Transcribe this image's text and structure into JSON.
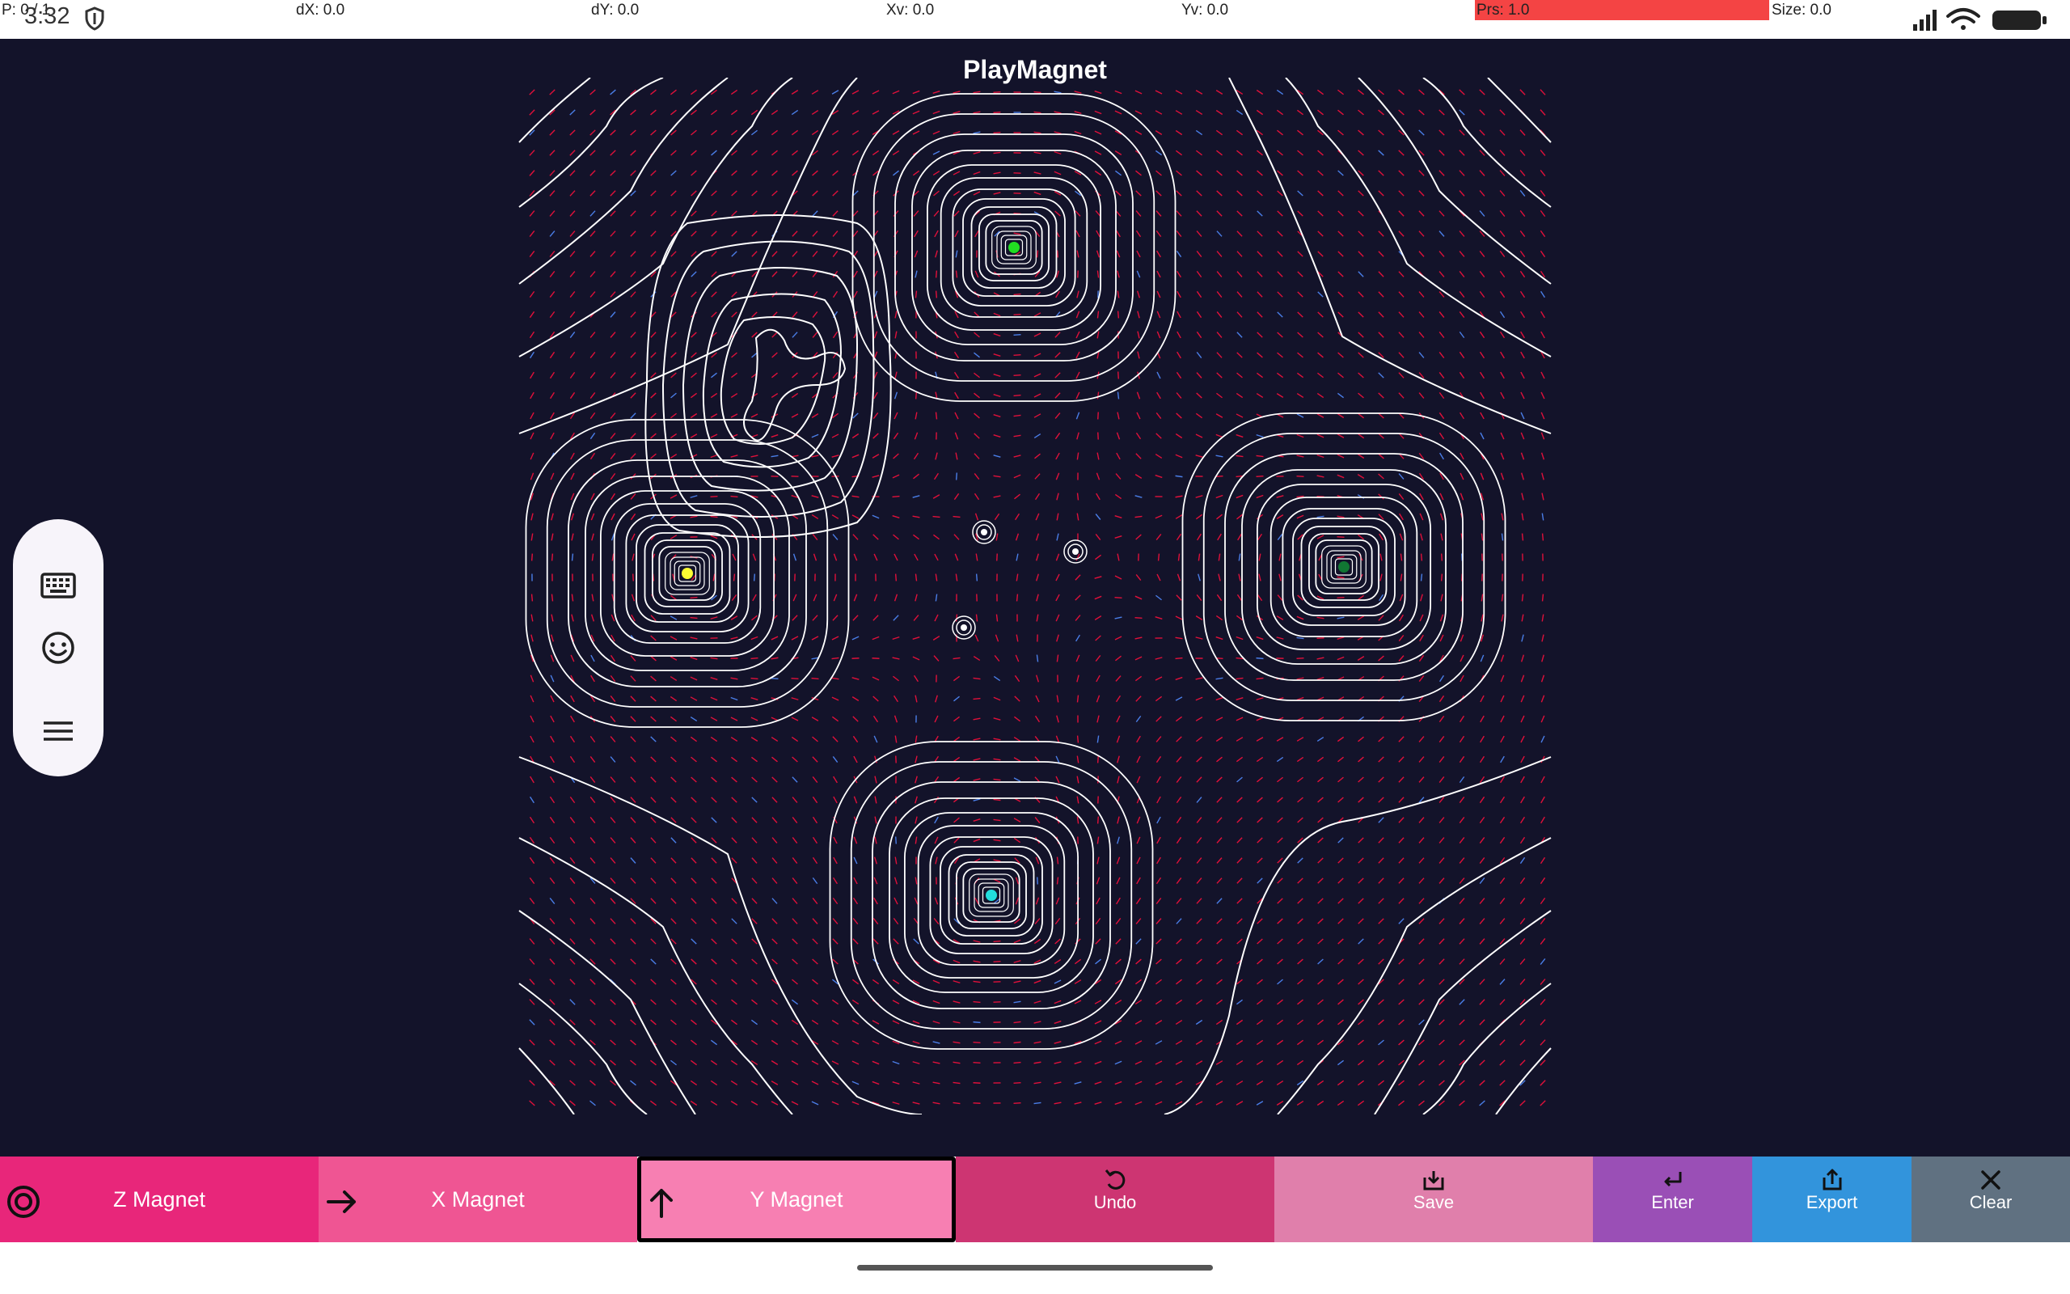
{
  "status_bar": {
    "p": "P: 0 / 1",
    "time": "3:32",
    "dx": "dX: 0.0",
    "dy": "dY: 0.0",
    "xv": "Xv: 0.0",
    "yv": "Yv: 0.0",
    "prs": "Prs: 1.0",
    "size": "Size: 0.0",
    "prs_color": "#f44444",
    "icons": [
      "shield-icon",
      "signal-icon",
      "wifi-icon",
      "battery-icon"
    ]
  },
  "app": {
    "title": "PlayMagnet",
    "background": "#13132a"
  },
  "field": {
    "line_color": "#ffffff",
    "arrow_color": "#e0103a",
    "arrow_alt_color": "#4a7ee8",
    "magnets": [
      {
        "name": "top",
        "color": "#22dd22"
      },
      {
        "name": "left",
        "color": "#ffff33"
      },
      {
        "name": "right",
        "color": "#117733"
      },
      {
        "name": "bottom",
        "color": "#22dddd"
      },
      {
        "name": "center-a",
        "color": "#ffffff"
      },
      {
        "name": "center-b",
        "color": "#ffffff"
      },
      {
        "name": "center-c",
        "color": "#ffffff"
      }
    ]
  },
  "side_panel": {
    "items": [
      "keyboard-icon",
      "emoji-icon",
      "menu-icon"
    ]
  },
  "toolbar": {
    "z_magnet": {
      "label": "Z Magnet",
      "icon": "ring-icon",
      "color": "#e8267a"
    },
    "x_magnet": {
      "label": "X Magnet",
      "icon": "arrow-right-icon",
      "color": "#ef5593"
    },
    "y_magnet": {
      "label": "Y Magnet",
      "icon": "arrow-up-icon",
      "color": "#f77fb2"
    },
    "undo": {
      "label": "Undo",
      "icon": "undo-icon",
      "color": "#cd3572"
    },
    "save": {
      "label": "Save",
      "icon": "save-icon",
      "color": "#e07fab"
    },
    "enter": {
      "label": "Enter",
      "icon": "enter-icon",
      "color": "#9a4fb6"
    },
    "export": {
      "label": "Export",
      "icon": "export-icon",
      "color": "#3294dc"
    },
    "clear": {
      "label": "Clear",
      "icon": "close-icon",
      "color": "#607181"
    }
  }
}
